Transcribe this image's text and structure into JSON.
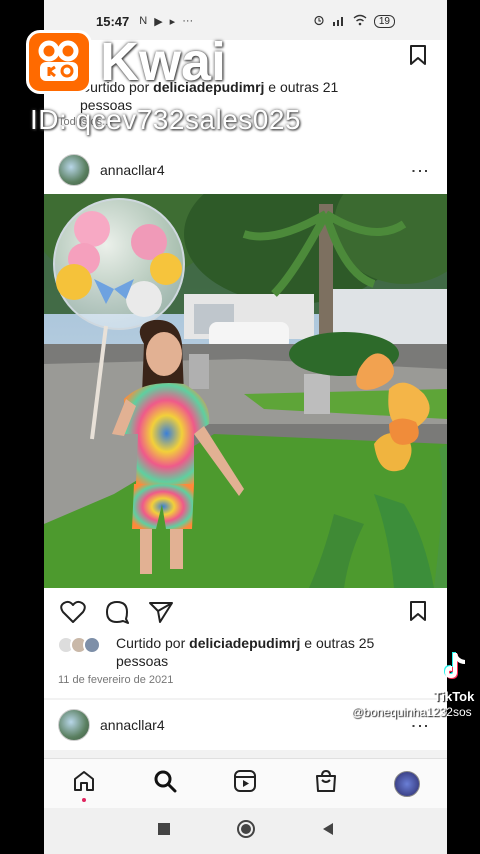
{
  "status_bar": {
    "time": "15:47",
    "left_icons": [
      "N",
      "▶",
      "▸",
      "···"
    ],
    "right_icons": [
      "⏰",
      "📶",
      "📡"
    ],
    "battery": "19"
  },
  "watermarks": {
    "kwai_label": "Kwai",
    "kwai_id": "ID: qcev732sales025",
    "tiktok_label": "TikTok",
    "tiktok_user": "@bonequinha1232sos"
  },
  "prev_post": {
    "liked_prefix": "Curtido por ",
    "liked_user": "deliciadepudimrj",
    "liked_suffix": " e outras 21 pessoas",
    "date": "Todos os..."
  },
  "post": {
    "username": "annacllar4",
    "liked_prefix": "Curtido por ",
    "liked_user": "deliciadepudimrj",
    "liked_suffix": " e outras 25 pessoas",
    "date": "11 de fevereiro de 2021"
  },
  "next_post": {
    "username": "annacllar4"
  },
  "colors": {
    "kwai_orange": "#ff6a00",
    "accent_dot": "#e0245e"
  },
  "icons": [
    "heart-icon",
    "comment-icon",
    "send-icon",
    "bookmark-icon",
    "home-icon",
    "search-icon",
    "reels-icon",
    "shop-icon",
    "profile-icon"
  ]
}
